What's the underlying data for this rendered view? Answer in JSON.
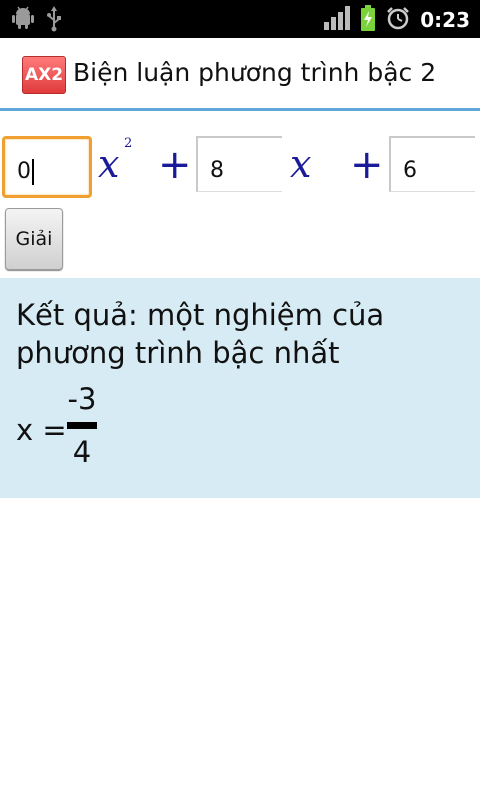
{
  "status_bar": {
    "time": "0:23",
    "icons": [
      "android-debug-icon",
      "usb-icon",
      "signal-icon",
      "battery-charging-icon",
      "alarm-icon"
    ]
  },
  "app": {
    "icon_text": "AX2",
    "title": "Biện luận phương trình bậc 2"
  },
  "equation": {
    "a": "0",
    "b": "8",
    "c": "6",
    "var": "x",
    "exponent": "2",
    "plus": "+"
  },
  "solve_button": {
    "label": "Giải"
  },
  "result": {
    "text": "Kết quả: một nghiệm của phương trình bậc nhất",
    "lhs": "x =",
    "numerator": "-3",
    "denominator": "4"
  },
  "colors": {
    "accent": "#5fa7d8",
    "result_bg": "#d7ebf4",
    "math_blue": "#1a1a9a",
    "focus_orange": "#f0a030",
    "app_icon_red": "#e03b3b"
  }
}
